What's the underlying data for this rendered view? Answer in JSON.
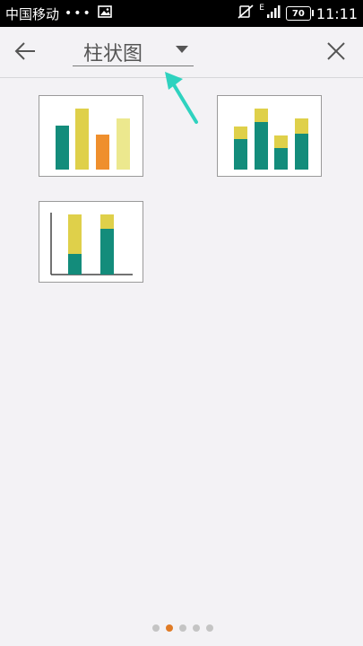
{
  "status_bar": {
    "carrier": "中国移动",
    "dots": "•••",
    "network": "E",
    "battery": "70",
    "time": "11:11"
  },
  "header": {
    "chart_type_label": "柱状图"
  },
  "colors": {
    "teal": "#138c7b",
    "yellow": "#dfd04a",
    "orange": "#ef8f2d",
    "pale_yellow": "#ece88e",
    "active_dot": "#e07b26",
    "arrow": "#2fd2bf"
  },
  "chart_options": [
    {
      "kind": "clustered-column"
    },
    {
      "kind": "stacked-column"
    },
    {
      "kind": "percent-stacked-column"
    }
  ],
  "pager": {
    "page_count": 5,
    "active_index": 1
  }
}
